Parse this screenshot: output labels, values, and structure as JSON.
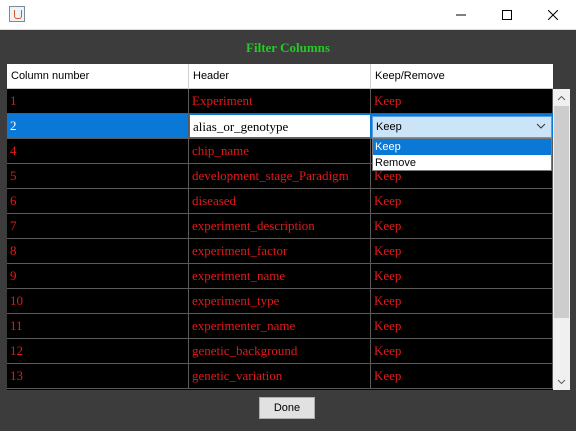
{
  "window": {
    "minimize_icon": "minimize-icon",
    "maximize_icon": "maximize-icon",
    "close_icon": "close-icon"
  },
  "dialog": {
    "title": "Filter Columns"
  },
  "table": {
    "headers": [
      "Column number",
      "Header",
      "Keep/Remove"
    ],
    "rows": [
      {
        "num": "1",
        "header": "Experiment",
        "action": "Keep"
      },
      {
        "num": "2",
        "header": "alias_or_genotype",
        "action": "Keep"
      },
      {
        "num": "4",
        "header": "chip_name",
        "action": "Keep"
      },
      {
        "num": "5",
        "header": "development_stage_Paradigm",
        "action": "Keep"
      },
      {
        "num": "6",
        "header": "diseased",
        "action": "Keep"
      },
      {
        "num": "7",
        "header": "experiment_description",
        "action": "Keep"
      },
      {
        "num": "8",
        "header": "experiment_factor",
        "action": "Keep"
      },
      {
        "num": "9",
        "header": "experiment_name",
        "action": "Keep"
      },
      {
        "num": "10",
        "header": "experiment_type",
        "action": "Keep"
      },
      {
        "num": "11",
        "header": "experimenter_name",
        "action": "Keep"
      },
      {
        "num": "12",
        "header": "genetic_background",
        "action": "Keep"
      },
      {
        "num": "13",
        "header": "genetic_variation",
        "action": "Keep"
      }
    ],
    "selected_row_index": 1,
    "editor": {
      "value": "Keep",
      "options": [
        "Keep",
        "Remove"
      ],
      "highlighted_option": "Keep"
    }
  },
  "buttons": {
    "done": "Done"
  },
  "colors": {
    "title": "#22cc22",
    "cell_text": "#e31919",
    "selection": "#0a78d7",
    "table_bg": "#000000",
    "dialog_bg": "#3c3c3c"
  }
}
